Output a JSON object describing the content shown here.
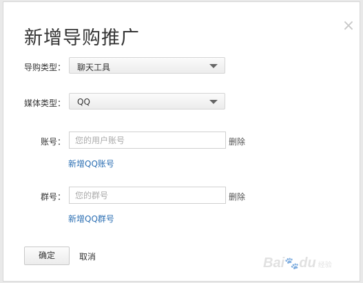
{
  "dialog": {
    "title": "新增导购推广",
    "close_glyph": "×"
  },
  "guide_type": {
    "label": "导购类型：",
    "value": "聊天工具"
  },
  "media_type": {
    "label": "媒体类型：",
    "value": "QQ"
  },
  "account": {
    "label": "账号：",
    "placeholder": "您的用户账号",
    "delete_label": "删除",
    "add_link": "新增QQ账号"
  },
  "group": {
    "label": "群号：",
    "placeholder": "您的群号",
    "delete_label": "删除",
    "add_link": "新增QQ群号"
  },
  "footer": {
    "confirm_label": "确定",
    "cancel_label": "取消"
  },
  "watermark": {
    "brand": "Bai",
    "brand_end": "du",
    "paw": "🐾",
    "sub": "经验"
  }
}
